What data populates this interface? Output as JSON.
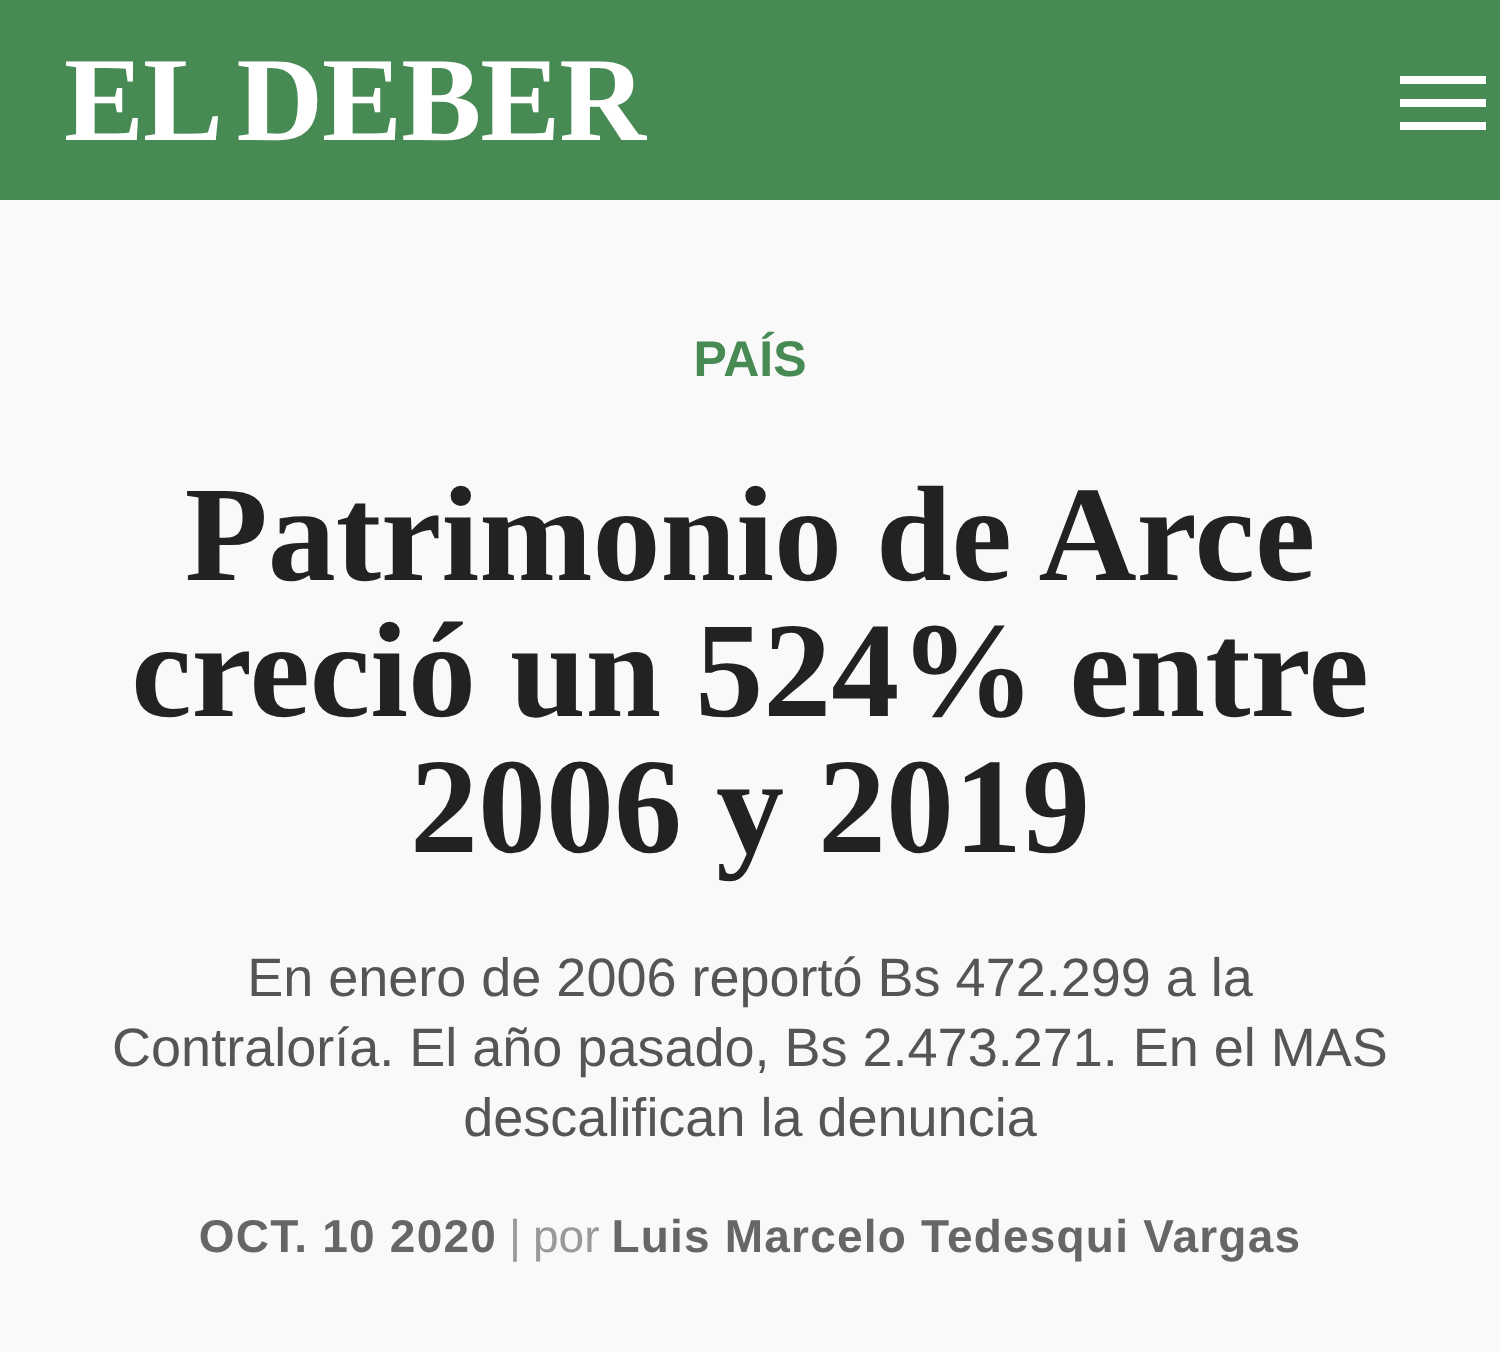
{
  "header": {
    "logo": "EL DEBER"
  },
  "article": {
    "section": "PAÍS",
    "headline": "Patrimonio de Arce creció un 524% entre 2006 y 2019",
    "summary": "En enero de 2006 reportó Bs 472.299 a la Contraloría. El año pasado, Bs 2.473.271. En el MAS descalifican la denuncia",
    "byline": {
      "date": "OCT. 10 2020",
      "separator": "|",
      "by": "por",
      "author": "Luis Marcelo Tedesqui Vargas"
    }
  }
}
